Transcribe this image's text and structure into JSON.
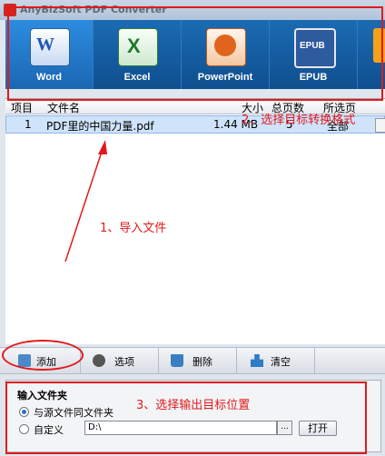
{
  "window": {
    "title": "AnyBizSoft PDF Converter"
  },
  "formats": [
    {
      "label": "Word",
      "icon": "word-icon",
      "active": true
    },
    {
      "label": "Excel",
      "icon": "excel-icon",
      "active": false
    },
    {
      "label": "PowerPoint",
      "icon": "powerpoint-icon",
      "active": false
    },
    {
      "label": "EPUB",
      "icon": "epub-icon",
      "active": false
    }
  ],
  "list": {
    "columns": [
      "项目",
      "文件名",
      "大小",
      "总页数",
      "所选页"
    ],
    "rows": [
      {
        "index": "1",
        "filename": "PDF里的中国力量.pdf",
        "size": "1.44  MB",
        "pages": "5",
        "selected": "全部"
      }
    ]
  },
  "toolbar": {
    "add": "添加",
    "options": "选项",
    "delete": "删除",
    "clear": "清空"
  },
  "output": {
    "title": "输入文件夹",
    "option_same": "与源文件同文件夹",
    "option_custom": "自定义",
    "path": "D:\\",
    "browse": "...",
    "open": "打开",
    "selected_option": "same"
  },
  "annotations": {
    "step1": "1、导入文件",
    "step2": "2、选择目标转换格式",
    "step3": "3、选择输出目标位置",
    "color": "#e3191b"
  },
  "colors": {
    "format_bar": "#1b6bb3",
    "selection": "#cfe3fb"
  }
}
